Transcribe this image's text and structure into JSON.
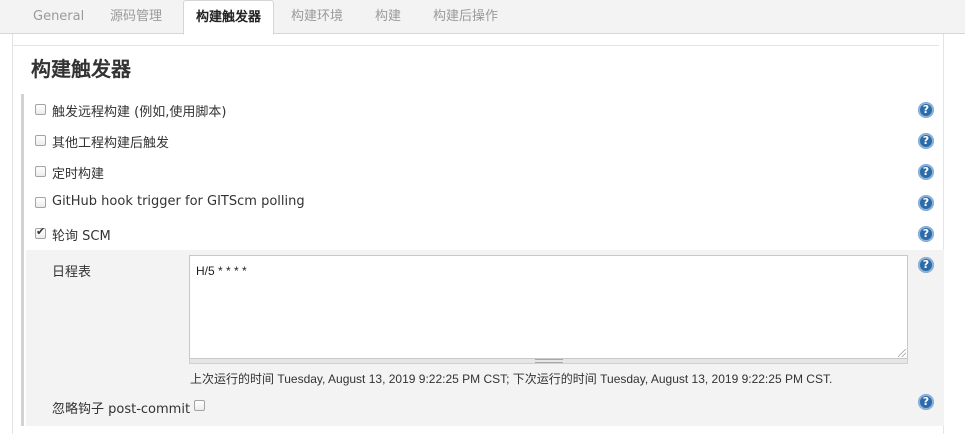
{
  "tabs": [
    {
      "label": "General",
      "active": false
    },
    {
      "label": "源码管理",
      "active": false
    },
    {
      "label": "构建触发器",
      "active": true
    },
    {
      "label": "构建环境",
      "active": false
    },
    {
      "label": "构建",
      "active": false
    },
    {
      "label": "构建后操作",
      "active": false
    }
  ],
  "section": {
    "title": "构建触发器"
  },
  "triggers": [
    {
      "label": "触发远程构建 (例如,使用脚本)",
      "checked": false
    },
    {
      "label": "其他工程构建后触发",
      "checked": false
    },
    {
      "label": "定时构建",
      "checked": false
    },
    {
      "label": "GitHub hook trigger for GITScm polling",
      "checked": false
    },
    {
      "label": "轮询 SCM",
      "checked": true
    }
  ],
  "poll_scm": {
    "schedule_label": "日程表",
    "schedule_value": "H/5 * * * *",
    "run_info": "上次运行的时间 Tuesday, August 13, 2019 9:22:25 PM CST; 下次运行的时间 Tuesday, August 13, 2019 9:22:25 PM CST.",
    "ignore_post_commit_label": "忽略钩子 post-commit",
    "ignore_post_commit_checked": false
  },
  "help_icon_glyph": "?",
  "icons": {
    "help": "help-icon",
    "checkbox": "checkbox",
    "resize": "resize-handle-icon"
  },
  "colors": {
    "help_icon": "#2d6aa8",
    "tab_bar": "#f3f3f3",
    "nested_block": "#f3f3f3"
  }
}
